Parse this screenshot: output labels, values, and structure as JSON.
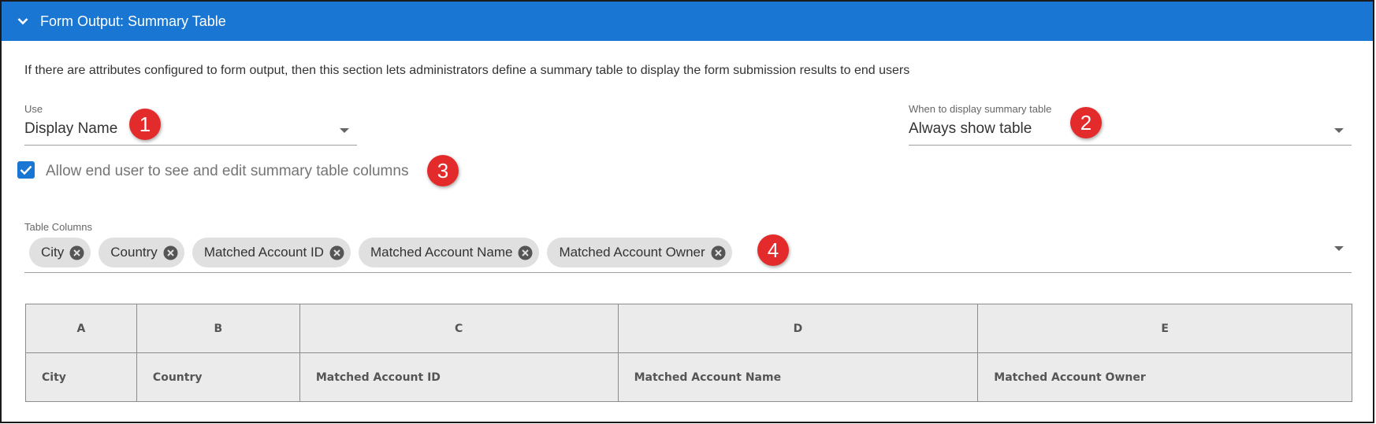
{
  "section": {
    "title": "Form Output: Summary Table",
    "description": "If there are attributes configured to form output, then this section lets administrators define a summary table to display the form submission results to end users"
  },
  "use_field": {
    "label": "Use",
    "value": "Display Name"
  },
  "display_field": {
    "label": "When to display summary table",
    "value": "Always show table"
  },
  "edit_columns": {
    "label": "Allow end user to see and edit summary table columns",
    "checked": true
  },
  "table_columns": {
    "label": "Table Columns",
    "chips": [
      "City",
      "Country",
      "Matched Account ID",
      "Matched Account Name",
      "Matched Account Owner"
    ]
  },
  "summary_table": {
    "headers": [
      "A",
      "B",
      "C",
      "D",
      "E"
    ],
    "row": [
      "City",
      "Country",
      "Matched Account ID",
      "Matched Account Name",
      "Matched Account Owner"
    ]
  },
  "callouts": [
    "1",
    "2",
    "3",
    "4"
  ],
  "colors": {
    "header_bg": "#1976d2",
    "callout": "#e32b2b",
    "chip_bg": "#e0e0e0",
    "table_bg": "#ebebeb"
  },
  "icons": {
    "collapse": "chevron-down-icon",
    "dropdown": "caret-down-icon",
    "chip_remove": "close-circle-icon",
    "checkbox": "checkmark-icon"
  }
}
